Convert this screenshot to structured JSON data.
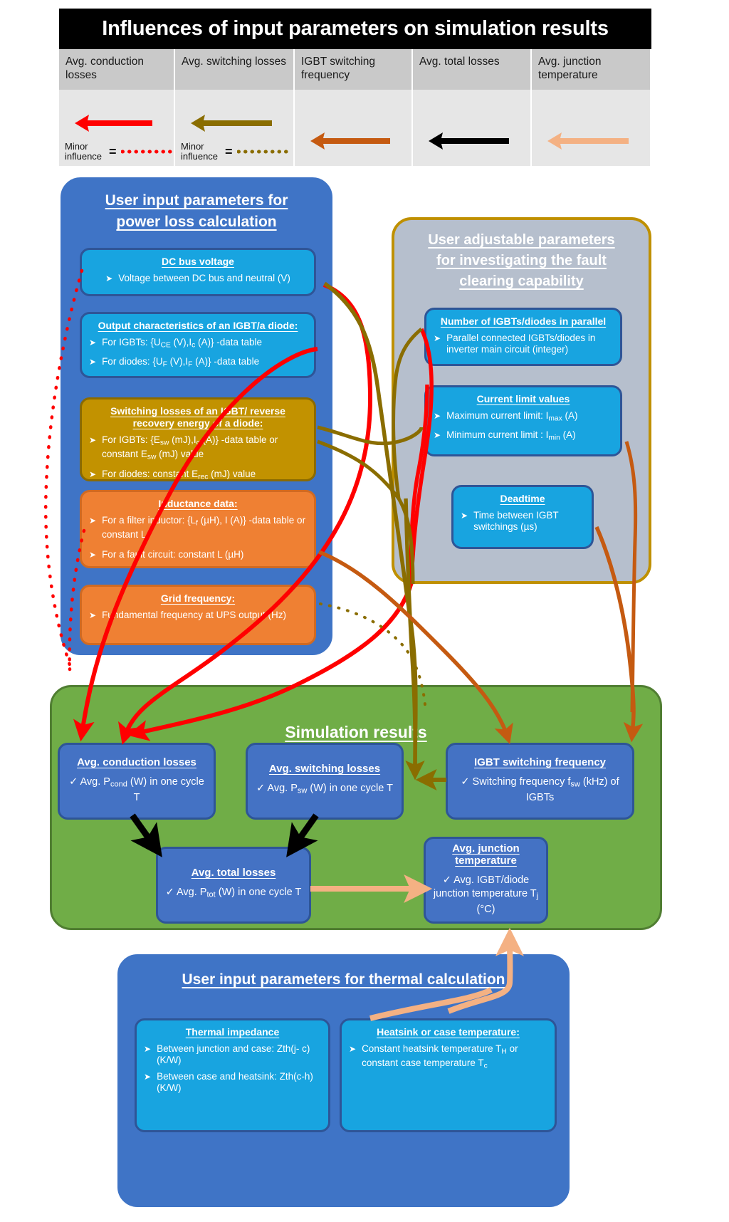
{
  "title": "Influences of input parameters on simulation results",
  "legend": {
    "columns": [
      {
        "header": "Avg. conduction losses",
        "arrow_color": "#ff0000",
        "minor_label": "Minor influence",
        "eq": "=",
        "has_minor": true
      },
      {
        "header": "Avg. switching losses",
        "arrow_color": "#8a6d00",
        "minor_label": "Minor influence",
        "eq": "=",
        "has_minor": true
      },
      {
        "header": "IGBT switching frequency",
        "arrow_color": "#c55a11",
        "minor_label": "",
        "eq": "",
        "has_minor": false
      },
      {
        "header": "Avg. total losses",
        "arrow_color": "#000000",
        "minor_label": "",
        "eq": "",
        "has_minor": false
      },
      {
        "header": "Avg. junction temperature",
        "arrow_color": "#f4b183",
        "minor_label": "",
        "eq": "",
        "has_minor": false
      }
    ]
  },
  "power_loss_panel": {
    "title_line1": "User input parameters for",
    "title_line2": "power loss calculation",
    "cards": [
      {
        "style": "cyan",
        "title": "DC bus voltage",
        "rows": [
          {
            "bullet": "➤",
            "text": "Voltage between  DC bus and neutral (V)",
            "center": true
          }
        ]
      },
      {
        "style": "cyan",
        "title": "Output characteristics of an IGBT/a diode:",
        "rows": [
          {
            "bullet": "➤",
            "text": "For IGBTs: {UCE (V),Ic (A)} -data table",
            "center": false
          },
          {
            "bullet": "➤",
            "text": "For diodes: {UF (V),IF (A)} -data table",
            "center": false
          }
        ]
      },
      {
        "style": "gold",
        "title": "Switching losses of  an IGBT/ reverse recovery energy of a diode:",
        "rows": [
          {
            "bullet": "➤",
            "text": "For IGBTs: {Esw (mJ),Ic (A)} -data table or constant Esw (mJ) value",
            "center": false
          },
          {
            "bullet": "➤",
            "text": "For diodes: constant Erec (mJ) value",
            "center": false
          }
        ]
      },
      {
        "style": "orange",
        "title": "Inductance data:",
        "rows": [
          {
            "bullet": "➤",
            "text": "For a filter inductor:  {Lf (µH), I (A)} -data table or constant Lf",
            "center": false
          },
          {
            "bullet": "➤",
            "text": "For a fault circuit: constant L (µH)",
            "center": false
          }
        ]
      },
      {
        "style": "orange",
        "title": "Grid frequency:",
        "rows": [
          {
            "bullet": "➤",
            "text": "Fundamental frequency at UPS output (Hz)",
            "center": false
          }
        ]
      }
    ]
  },
  "fault_panel": {
    "title_line1": "User adjustable parameters",
    "title_line2": "for investigating the fault",
    "title_line3": "clearing capability",
    "cards": [
      {
        "style": "cyan",
        "title": "Number of IGBTs/diodes in parallel",
        "rows": [
          {
            "bullet": "➤",
            "text": "Parallel connected IGBTs/diodes in inverter main circuit (integer)",
            "center": false
          }
        ]
      },
      {
        "style": "cyan",
        "title": "Current limit values",
        "rows": [
          {
            "bullet": "➤",
            "text": "Maximum current limit: Imax (A)",
            "center": false
          },
          {
            "bullet": "➤",
            "text": "Minimum current limit : Imin (A)",
            "center": false
          }
        ]
      },
      {
        "style": "cyan",
        "title": "Deadtime",
        "rows": [
          {
            "bullet": "➤",
            "text": "Time between IGBT switchings (µs)",
            "center": false
          }
        ]
      }
    ]
  },
  "simulation_results": {
    "title": "Simulation results",
    "boxes": [
      {
        "title": "Avg. conduction losses",
        "body": "✓  Avg. Pcond (W) in one cycle T"
      },
      {
        "title": "Avg. switching losses",
        "body": "✓  Avg. Psw (W) in one cycle T"
      },
      {
        "title": "IGBT switching frequency",
        "body": "✓  Switching frequency fsw (kHz) of IGBTs"
      },
      {
        "title": "Avg. total losses",
        "body": "✓  Avg.  Ptot (W) in one cycle T"
      },
      {
        "title": "Avg. junction temperature",
        "body": "✓  Avg. IGBT/diode junction temperature Tj (°C)"
      }
    ]
  },
  "thermal_panel": {
    "title": "User input parameters for thermal calculation",
    "cards": [
      {
        "style": "cyan",
        "title": "Thermal impedance",
        "rows": [
          {
            "bullet": "➤",
            "text": "Between junction and case: Zth(j- c) (K/W)",
            "center": false
          },
          {
            "bullet": "➤",
            "text": "Between case and heatsink: Zth(c-h) (K/W)",
            "center": false
          }
        ]
      },
      {
        "style": "cyan",
        "title": "Heatsink or case temperature:",
        "rows": [
          {
            "bullet": "➤",
            "text": "Constant heatsink temperature TH or constant  case temperature Tc",
            "center": true
          }
        ]
      }
    ]
  },
  "colors": {
    "red": "#ff0000",
    "olive": "#8a6d00",
    "orange_arrow": "#c55a11",
    "black": "#000000",
    "peach": "#f4b183",
    "panel_blue": "#3f74c6",
    "panel_green": "#70ad47",
    "panel_gray": "#b6bfcd",
    "gold_border": "#bf9000",
    "card_cyan": "#18a4e0",
    "card_gold": "#c29200",
    "card_orange": "#ef8033",
    "card_blue": "#4472c4"
  }
}
